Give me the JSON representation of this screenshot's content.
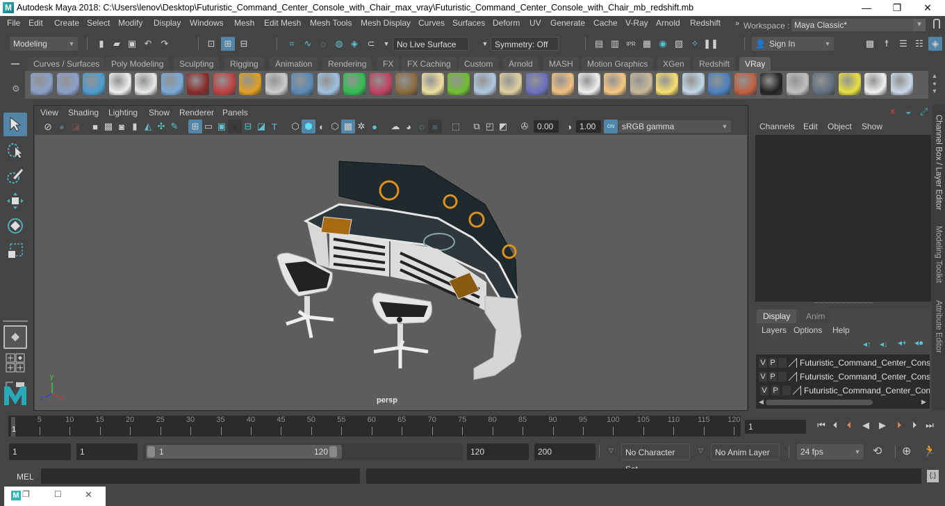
{
  "titlebar": {
    "logo": "M",
    "title": "Autodesk Maya 2018: C:\\Users\\lenov\\Desktop\\Futuristic_Command_Center_Console_with_Chair_max_vray\\Futuristic_Command_Center_Console_with_Chair_mb_redshift.mb",
    "minimize_icon": "—",
    "maximize_icon": "❐",
    "close_icon": "✕"
  },
  "menubar": {
    "items": [
      "File",
      "Edit",
      "Create",
      "Select",
      "Modify",
      "Display",
      "Windows",
      "Mesh",
      "Edit Mesh",
      "Mesh Tools",
      "Mesh Display",
      "Curves",
      "Surfaces",
      "Deform",
      "UV",
      "Generate",
      "Cache",
      "V-Ray",
      "Arnold",
      "Redshift"
    ],
    "overflow": "»",
    "workspace_label": "Workspace :",
    "workspace_value": "Maya Classic*"
  },
  "statusline": {
    "mode": "Modeling",
    "live_surface": "No Live Surface",
    "symmetry": "Symmetry: Off",
    "sign_in": "Sign In"
  },
  "shelf": {
    "tabs": [
      "Curves / Surfaces",
      "Poly Modeling",
      "Sculpting",
      "Rigging",
      "Animation",
      "Rendering",
      "FX",
      "FX Caching",
      "Custom",
      "Arnold",
      "MASH",
      "Motion Graphics",
      "XGen",
      "Redshift",
      "VRay"
    ],
    "active_tab": "VRay",
    "icons": [
      "vray-export-icon",
      "vray-import-icon",
      "vray-list-icon",
      "vray-logo-icon",
      "vray-document-icon",
      "vray-material-icon",
      "vray-camera-icon",
      "vray-shader-balls-icon",
      "vray-fire-icon",
      "vray-proxy-icon",
      "vray-box-icon",
      "vray-cone-icon",
      "vray-light-icon",
      "vray-mesh-icon",
      "vray-texture-icon",
      "vray-sphere-icon",
      "vray-grass-icon",
      "vray-fur-icon",
      "vray-curve-icon",
      "vray-dome-icon",
      "vray-dome-light-icon",
      "vray-spot-icon",
      "vray-sphere-light-icon",
      "vray-ies-icon",
      "vray-sun-icon",
      "vray-plane-icon",
      "vray-blue-sphere-icon",
      "vray-flag-sphere-icon",
      "vray-checker-icon",
      "vray-frame-buffer-icon",
      "vray-settings-icon",
      "vray-bulb-icon",
      "vray-cloud-icon",
      "vray-help-icon"
    ]
  },
  "viewport": {
    "menu": [
      "View",
      "Shading",
      "Lighting",
      "Show",
      "Renderer",
      "Panels"
    ],
    "exposure": "0.00",
    "gamma": "1.00",
    "color_space": "sRGB gamma",
    "color_mgmt_badge": "ON",
    "camera_label": "persp",
    "axis": {
      "x": "x",
      "y": "y",
      "z": "z"
    }
  },
  "channel_box": {
    "menu": [
      "Channels",
      "Edit",
      "Object",
      "Show"
    ]
  },
  "layer_editor": {
    "tabs": [
      "Display",
      "Anim"
    ],
    "active_tab": "Display",
    "menu": [
      "Layers",
      "Options",
      "Help"
    ],
    "layers": [
      {
        "v": "V",
        "p": "P",
        "name": "Futuristic_Command_Center_Consol"
      },
      {
        "v": "V",
        "p": "P",
        "name": "Futuristic_Command_Center_Consol"
      },
      {
        "v": "V",
        "p": "P",
        "name": "Futuristic_Command_Center_Consc"
      }
    ]
  },
  "side_tabs": [
    "Channel Box / Layer Editor",
    "Modeling Toolkit",
    "Attribute Editor"
  ],
  "timeline": {
    "current_frame_marker": "1",
    "ticks": [
      5,
      10,
      15,
      20,
      25,
      30,
      35,
      40,
      45,
      50,
      55,
      60,
      65,
      70,
      75,
      80,
      85,
      90,
      95,
      100,
      105,
      110,
      115,
      120
    ],
    "start": 1,
    "end": 120,
    "current_frame": "1"
  },
  "range": {
    "start_frame": "1",
    "playback_start": "1",
    "slider_min": "1",
    "slider_max": "120",
    "playback_end": "120",
    "end_frame": "200",
    "character_set": "No Character Set",
    "anim_layer": "No Anim Layer",
    "fps": "24 fps"
  },
  "command_line": {
    "label": "MEL",
    "input": "",
    "result": ""
  },
  "colors": {
    "accent": "#5285a6",
    "background": "#444444",
    "viewport_bg": "#5d5d5d",
    "field_dark": "#2b2b2b"
  }
}
